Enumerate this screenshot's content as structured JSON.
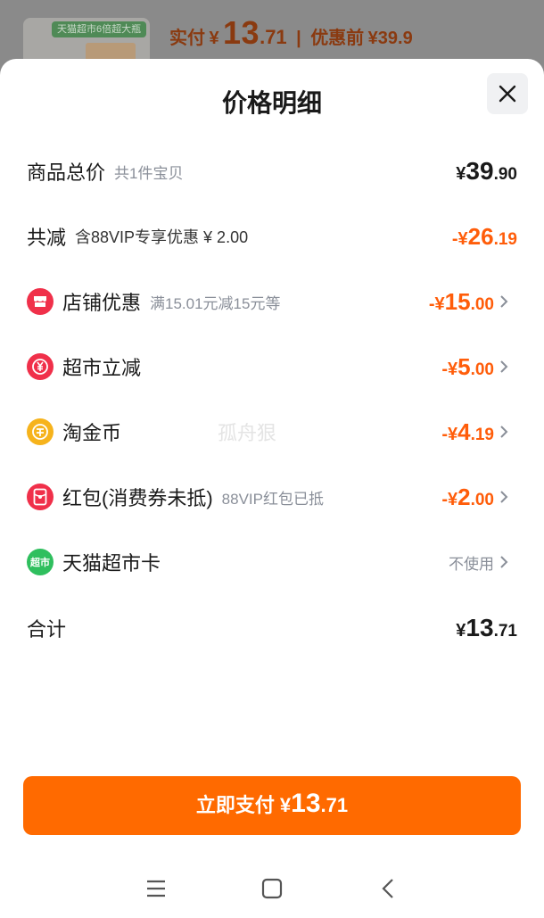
{
  "background": {
    "thumb_tag": "天猫超市6倍超大瓶",
    "paid_label": "实付",
    "paid_symbol": "¥",
    "paid_int": "13",
    "paid_dec": ".71",
    "separator": "|",
    "before_label": "优惠前",
    "before_price": "¥39.9"
  },
  "sheet": {
    "title": "价格明细",
    "watermark": "孤舟狠"
  },
  "rows": {
    "total": {
      "label": "商品总价",
      "sub": "共1件宝贝",
      "sym": "¥",
      "int": "39",
      "dec": ".90"
    },
    "reduce": {
      "label": "共减",
      "sub": "含88VIP专享优惠 ¥ 2.00",
      "sym": "-¥",
      "int": "26",
      "dec": ".19"
    },
    "shop": {
      "label": "店铺优惠",
      "sub": "满15.01元减15元等",
      "sym": "-¥",
      "int": "15",
      "dec": ".00"
    },
    "market": {
      "label": "超市立减",
      "sub": "",
      "sym": "-¥",
      "int": "5",
      "dec": ".00"
    },
    "coin": {
      "label": "淘金币",
      "sub": "",
      "sym": "-¥",
      "int": "4",
      "dec": ".19"
    },
    "redpack": {
      "label": "红包(消费券未抵)",
      "sub": "88VIP红包已抵",
      "sym": "-¥",
      "int": "2",
      "dec": ".00"
    },
    "card": {
      "label": "天猫超市卡",
      "status": "不使用",
      "icon_text": "超市"
    },
    "sum": {
      "label": "合计",
      "sym": "¥",
      "int": "13",
      "dec": ".71"
    }
  },
  "pay_button": {
    "label": "立即支付",
    "sym": "¥",
    "int": "13",
    "dec": ".71"
  },
  "colors": {
    "accent": "#ff6a00",
    "discount": "#ff5d0a",
    "shop_icon": "#f0304a",
    "coin_icon": "#f6b31c",
    "card_icon": "#2fbf5e"
  }
}
